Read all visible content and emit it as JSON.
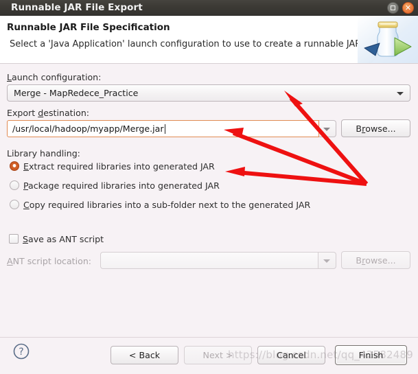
{
  "window": {
    "title": "Runnable JAR File Export",
    "restore_icon": "restore-icon",
    "close_icon": "close-icon",
    "close_glyph": "✕"
  },
  "header": {
    "title": "Runnable JAR File Specification",
    "description": "Select a 'Java Application' launch configuration to use to create a runnable JAR.",
    "art_icon": "jar-export-illustration"
  },
  "form": {
    "launch_configuration": {
      "label": "Launch configuration:",
      "mnemonic": "L",
      "rest": "aunch configuration:",
      "value": "Merge - MapRedece_Practice",
      "caret_icon": "chevron-down-icon"
    },
    "export_destination": {
      "label_pre": "Export ",
      "mnemonic": "d",
      "label_post": "estination:",
      "value": "/usr/local/hadoop/myapp/Merge.jar",
      "browse_label_pre": "B",
      "browse_mnemonic": "r",
      "browse_label_post": "owse...",
      "caret_icon": "chevron-down-icon"
    },
    "library_handling": {
      "label": "Library handling:",
      "selected_index": 0,
      "options": [
        {
          "mnemonic": "E",
          "pre": "",
          "post": "xtract required libraries into generated JAR"
        },
        {
          "mnemonic": "P",
          "pre": "",
          "post": "ackage required libraries into generated JAR"
        },
        {
          "mnemonic": "C",
          "pre": "",
          "post": "opy required libraries into a sub-folder next to the generated JAR"
        }
      ]
    },
    "ant": {
      "checkbox_label_pre": "",
      "checkbox_mnemonic": "S",
      "checkbox_label_post": "ave as ANT script",
      "checked": false,
      "location_mnemonic": "A",
      "location_label_post": "NT script location:",
      "location_value": "",
      "browse_label_pre": "B",
      "browse_mnemonic": "r",
      "browse_label_post": "owse...",
      "caret_icon": "chevron-down-icon"
    }
  },
  "footer": {
    "help_icon": "help-question-icon",
    "buttons": [
      {
        "label": "< Back",
        "state": "enabled"
      },
      {
        "label": "Next >",
        "state": "disabled"
      },
      {
        "label": "Cancel",
        "state": "enabled"
      },
      {
        "label": "Finish",
        "state": "default"
      }
    ]
  },
  "annotations": {
    "arrow_color": "#ee1111",
    "watermark": "https://blog.csdn.net/qq_42582489"
  },
  "colors": {
    "titlebar": "#3b3934",
    "body": "#f7f2f5",
    "header": "#ffffff",
    "accent_focus": "#e08a52",
    "radio_selected": "#c4541f",
    "close_button": "#e2622a"
  }
}
